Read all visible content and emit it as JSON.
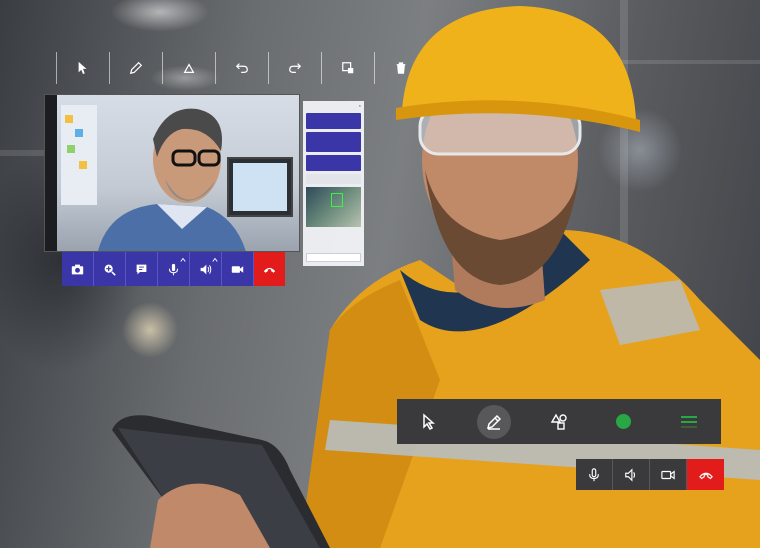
{
  "floating_toolbar": {
    "icons": [
      "pointer-icon",
      "pencil-icon",
      "shapes-icon",
      "undo-icon",
      "redo-icon",
      "screenshot-icon",
      "trash-icon"
    ]
  },
  "call_controls_left": {
    "buttons": [
      "camera-icon",
      "zoom-in-icon",
      "chat-icon",
      "microphone-icon",
      "speaker-icon",
      "video-camera-icon",
      "end-call-icon"
    ],
    "end_call_color": "#e21b1b",
    "button_color": "#3b36a8"
  },
  "chat_panel": {
    "messages": [
      {
        "text": "",
        "style": "sent"
      },
      {
        "text": "",
        "style": "sent"
      },
      {
        "text": "",
        "style": "sent"
      },
      {
        "text": "",
        "style": "received"
      }
    ],
    "input_placeholder": ""
  },
  "annotation_toolbar": {
    "tools": [
      "pointer-icon",
      "pencil-icon",
      "shapes-icon",
      "color-dot",
      "stroke-width-icon"
    ],
    "active_tool": "pencil-icon",
    "active_color": "#27a844"
  },
  "call_controls_right": {
    "buttons": [
      "microphone-icon",
      "speaker-icon",
      "video-camera-icon",
      "end-call-icon"
    ],
    "end_call_color": "#e21b1b"
  }
}
